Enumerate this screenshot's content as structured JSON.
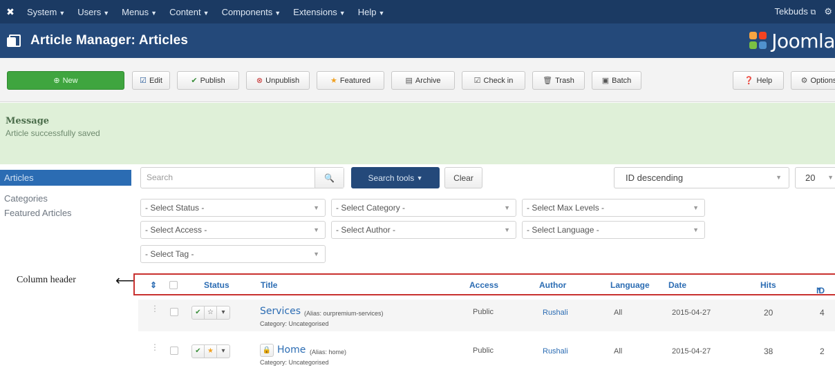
{
  "topnav": {
    "menu": [
      "System",
      "Users",
      "Menus",
      "Content",
      "Components",
      "Extensions",
      "Help"
    ],
    "user": "Tekbuds"
  },
  "title": "Article Manager: Articles",
  "brand": "Joomla",
  "toolbar": {
    "new": "New",
    "edit": "Edit",
    "publish": "Publish",
    "unpublish": "Unpublish",
    "featured": "Featured",
    "archive": "Archive",
    "checkin": "Check in",
    "trash": "Trash",
    "batch": "Batch",
    "help": "Help",
    "options": "Options"
  },
  "message": {
    "title": "Message",
    "body": "Article successfully saved"
  },
  "sidebar": {
    "items": [
      "Articles",
      "Categories",
      "Featured Articles"
    ]
  },
  "search": {
    "placeholder": "Search",
    "tools_label": "Search tools",
    "clear_label": "Clear",
    "ordering": "ID descending",
    "limit": "20"
  },
  "filters": {
    "status": "- Select Status -",
    "category": "- Select Category -",
    "max_levels": "- Select Max Levels -",
    "access": "- Select Access -",
    "author": "- Select Author -",
    "language": "- Select Language -",
    "tag": "- Select Tag -"
  },
  "annotation": "Column header",
  "columns": {
    "status": "Status",
    "title": "Title",
    "access": "Access",
    "author": "Author",
    "language": "Language",
    "date": "Date",
    "hits": "Hits",
    "id": "ID"
  },
  "rows": [
    {
      "title": "Services",
      "alias": "(Alias: ourpremium-services)",
      "category": "Category: Uncategorised",
      "access": "Public",
      "author": "Rushali",
      "language": "All",
      "date": "2015-04-27",
      "hits": "20",
      "id": "4"
    },
    {
      "title": "Home",
      "alias": "(Alias: home)",
      "category": "Category: Uncategorised",
      "access": "Public",
      "author": "Rushali",
      "language": "All",
      "date": "2015-04-27",
      "hits": "38",
      "id": "2"
    }
  ],
  "colors": {
    "topnav": "#1b3a63",
    "titlebar": "#24497a",
    "new_button": "#3fa53f",
    "message_bg": "#dff0d8",
    "link": "#2b6cb3",
    "annotation_box": "#c8302e"
  }
}
